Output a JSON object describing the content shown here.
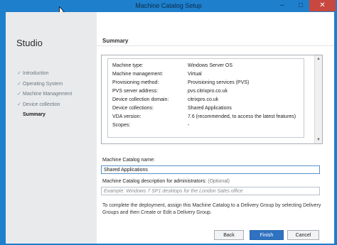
{
  "window": {
    "title": "Machine Catalog Setup",
    "controls": {
      "minimize": "–",
      "maximize": "□",
      "close": "✕"
    }
  },
  "sidebar": {
    "brand": "Studio",
    "steps": [
      {
        "label": "Introduction",
        "completed": true
      },
      {
        "label": "Operating System",
        "completed": true
      },
      {
        "label": "Machine Management",
        "completed": true
      },
      {
        "label": "Device collection",
        "completed": true
      },
      {
        "label": "Summary",
        "completed": false,
        "active": true
      }
    ],
    "check_glyph": "✓"
  },
  "main": {
    "section_title": "Summary",
    "summary": [
      {
        "key": "Machine type:",
        "value": "Windows Server OS"
      },
      {
        "key": "Machine management:",
        "value": "Virtual"
      },
      {
        "key": "Provisioning method:",
        "value": "Provisioning services (PVS)"
      },
      {
        "key": "PVS server address:",
        "value": "pvs.citrixpro.co.uk"
      },
      {
        "key": "Device collection domain:",
        "value": "citrixpro.co.uk"
      },
      {
        "key": "Device collections:",
        "value": "Shared Applications"
      },
      {
        "key": "VDA version:",
        "value": "7.6 (recommended, to access the latest features)"
      },
      {
        "key": "Scopes:",
        "value": "-"
      }
    ],
    "catalog_name_label": "Machine Catalog name:",
    "catalog_name_value": "Shared Applications",
    "description_label": "Machine Catalog description for administrators:",
    "description_optional": "(Optional)",
    "description_placeholder": "Example: Windows 7 SP1 desktops for the London Sales office",
    "instructions": "To complete the deployment, assign this Machine Catalog to a Delivery Group by selecting Delivery Groups and then Create or Edit a Delivery Group."
  },
  "buttons": {
    "back": "Back",
    "finish": "Finish",
    "cancel": "Cancel"
  },
  "colors": {
    "accent": "#2f72c1",
    "titlebar": "#1e7fcc",
    "close": "#c8473e"
  }
}
